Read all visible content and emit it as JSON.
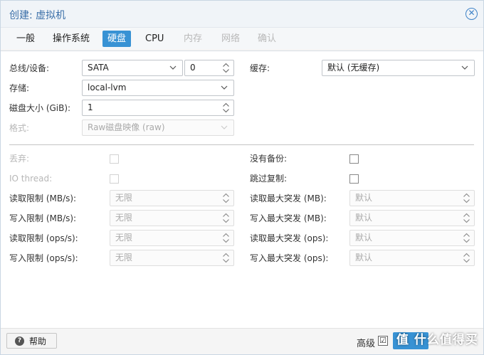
{
  "window": {
    "title": "创建: 虚拟机"
  },
  "tabs": [
    {
      "label": "一般",
      "state": "normal"
    },
    {
      "label": "操作系统",
      "state": "normal"
    },
    {
      "label": "硬盘",
      "state": "active"
    },
    {
      "label": "CPU",
      "state": "normal"
    },
    {
      "label": "内存",
      "state": "disabled"
    },
    {
      "label": "网络",
      "state": "disabled"
    },
    {
      "label": "确认",
      "state": "disabled"
    }
  ],
  "disk": {
    "bus_label": "总线/设备:",
    "bus_value": "SATA",
    "device_value": "0",
    "storage_label": "存储:",
    "storage_value": "local-lvm",
    "size_label": "磁盘大小 (GiB):",
    "size_value": "1",
    "format_label": "格式:",
    "format_value": "Raw磁盘映像 (raw)",
    "cache_label": "缓存:",
    "cache_value": "默认 (无缓存)"
  },
  "advanced": {
    "discard_label": "丢弃:",
    "io_thread_label": "IO thread:",
    "no_backup_label": "没有备份:",
    "skip_replication_label": "跳过复制:",
    "read_limit_mb_label": "读取限制 (MB/s):",
    "read_limit_mb_value": "无限",
    "write_limit_mb_label": "写入限制 (MB/s):",
    "write_limit_mb_value": "无限",
    "read_limit_ops_label": "读取限制 (ops/s):",
    "read_limit_ops_value": "无限",
    "write_limit_ops_label": "写入限制 (ops/s):",
    "write_limit_ops_value": "无限",
    "read_burst_mb_label": "读取最大突发 (MB):",
    "read_burst_mb_value": "默认",
    "write_burst_mb_label": "写入最大突发 (MB):",
    "write_burst_mb_value": "默认",
    "read_burst_ops_label": "读取最大突发 (ops):",
    "read_burst_ops_value": "默认",
    "write_burst_ops_label": "写入最大突发 (ops):",
    "write_burst_ops_value": "默认"
  },
  "footer": {
    "help_label": "帮助",
    "advanced_label": "高级",
    "advanced_checked_mark": "☑",
    "watermark": "值 什么值得买"
  },
  "icons": {
    "close": "close-circle-icon",
    "dropdown": "chevron-down-icon",
    "spinner": "spinner-arrows-icon",
    "help": "question-circle-icon"
  },
  "colors": {
    "accent": "#3892d4",
    "title": "#3a6fa8"
  }
}
